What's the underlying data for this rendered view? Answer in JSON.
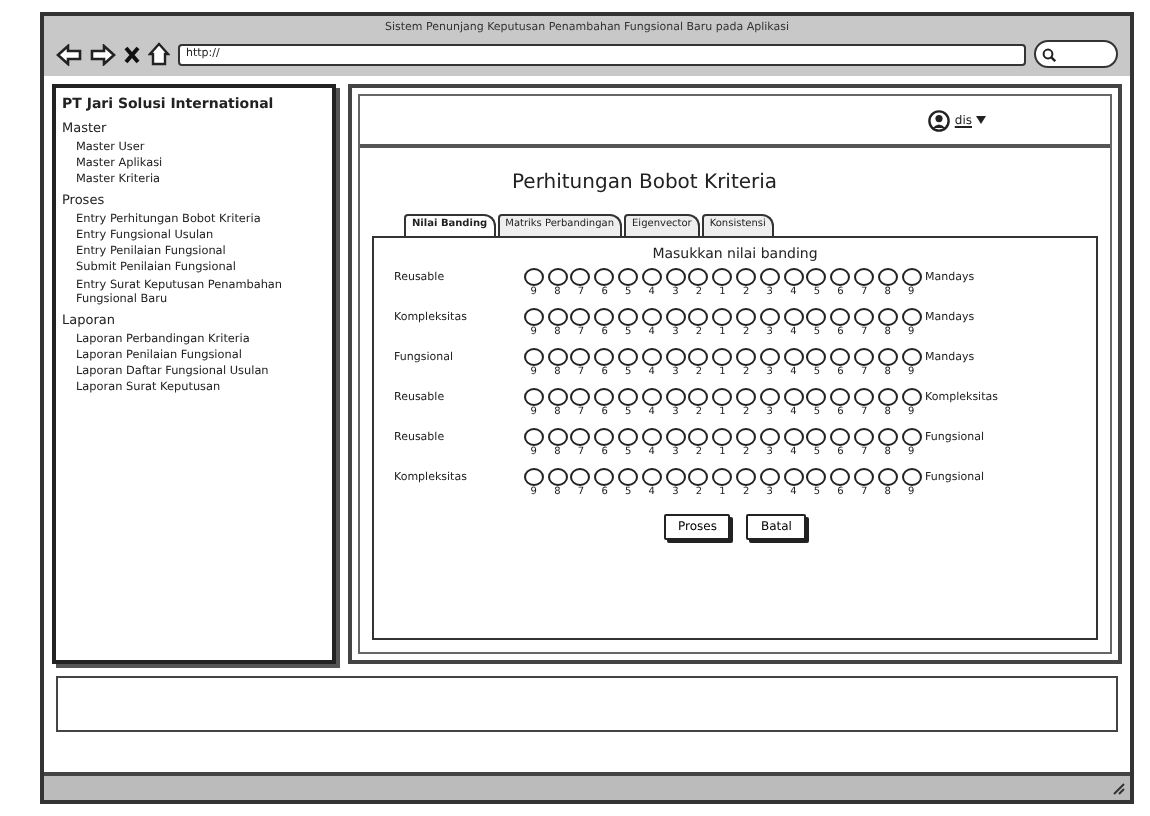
{
  "window": {
    "title": "Sistem Penunjang Keputusan Penambahan Fungsional Baru pada Aplikasi",
    "address": "http://"
  },
  "sidebar": {
    "title": "PT Jari Solusi International",
    "sections": [
      {
        "label": "Master",
        "items": [
          "Master User",
          "Master Aplikasi",
          "Master Kriteria"
        ]
      },
      {
        "label": "Proses",
        "items": [
          "Entry Perhitungan Bobot Kriteria",
          "Entry Fungsional Usulan",
          "Entry Penilaian Fungsional",
          "Submit Penilaian Fungsional",
          "Entry Surat Keputusan Penambahan Fungsional Baru"
        ]
      },
      {
        "label": "Laporan",
        "items": [
          "Laporan Perbandingan Kriteria",
          "Laporan Penilaian Fungsional",
          "Laporan Daftar Fungsional Usulan",
          "Laporan Surat Keputusan"
        ]
      }
    ]
  },
  "user": {
    "name": "dis"
  },
  "page_title": "Perhitungan Bobot Kriteria",
  "tabs": [
    {
      "label": "Nilai Banding",
      "selected": true
    },
    {
      "label": "Matriks Perbandingan",
      "selected": false
    },
    {
      "label": "Eigenvector",
      "selected": false
    },
    {
      "label": "Konsistensi",
      "selected": false
    }
  ],
  "form": {
    "heading": "Masukkan nilai banding",
    "rows": [
      {
        "left": "Reusable",
        "right": "Mandays",
        "options": [
          {
            "label": "9",
            "selected": false
          },
          {
            "label": "8",
            "selected": false
          },
          {
            "label": "7",
            "selected": false
          },
          {
            "label": "6",
            "selected": false
          },
          {
            "label": "5",
            "selected": false
          },
          {
            "label": "4",
            "selected": false
          },
          {
            "label": "3",
            "selected": false
          },
          {
            "label": "2",
            "selected": false
          },
          {
            "label": "1",
            "selected": false
          },
          {
            "label": "2",
            "selected": false
          },
          {
            "label": "3",
            "selected": false
          },
          {
            "label": "4",
            "selected": false
          },
          {
            "label": "5",
            "selected": false
          },
          {
            "label": "6",
            "selected": false
          },
          {
            "label": "7",
            "selected": false
          },
          {
            "label": "8",
            "selected": false
          },
          {
            "label": "9",
            "selected": false
          }
        ]
      },
      {
        "left": "Kompleksitas",
        "right": "Mandays",
        "options": [
          {
            "label": "9",
            "selected": false
          },
          {
            "label": "8",
            "selected": false
          },
          {
            "label": "7",
            "selected": false
          },
          {
            "label": "6",
            "selected": false
          },
          {
            "label": "5",
            "selected": false
          },
          {
            "label": "4",
            "selected": false
          },
          {
            "label": "3",
            "selected": false
          },
          {
            "label": "2",
            "selected": false
          },
          {
            "label": "1",
            "selected": false
          },
          {
            "label": "2",
            "selected": false
          },
          {
            "label": "3",
            "selected": false
          },
          {
            "label": "4",
            "selected": false
          },
          {
            "label": "5",
            "selected": false
          },
          {
            "label": "6",
            "selected": false
          },
          {
            "label": "7",
            "selected": false
          },
          {
            "label": "8",
            "selected": false
          },
          {
            "label": "9",
            "selected": false
          }
        ]
      },
      {
        "left": "Fungsional",
        "right": "Mandays",
        "options": [
          {
            "label": "9",
            "selected": false
          },
          {
            "label": "8",
            "selected": false
          },
          {
            "label": "7",
            "selected": false
          },
          {
            "label": "6",
            "selected": false
          },
          {
            "label": "5",
            "selected": false
          },
          {
            "label": "4",
            "selected": false
          },
          {
            "label": "3",
            "selected": false
          },
          {
            "label": "2",
            "selected": false
          },
          {
            "label": "1",
            "selected": false
          },
          {
            "label": "2",
            "selected": false
          },
          {
            "label": "3",
            "selected": false
          },
          {
            "label": "4",
            "selected": false
          },
          {
            "label": "5",
            "selected": false
          },
          {
            "label": "6",
            "selected": false
          },
          {
            "label": "7",
            "selected": false
          },
          {
            "label": "8",
            "selected": false
          },
          {
            "label": "9",
            "selected": false
          }
        ]
      },
      {
        "left": "Reusable",
        "right": "Kompleksitas",
        "options": [
          {
            "label": "9",
            "selected": false
          },
          {
            "label": "8",
            "selected": false
          },
          {
            "label": "7",
            "selected": false
          },
          {
            "label": "6",
            "selected": false
          },
          {
            "label": "5",
            "selected": false
          },
          {
            "label": "4",
            "selected": false
          },
          {
            "label": "3",
            "selected": false
          },
          {
            "label": "2",
            "selected": false
          },
          {
            "label": "1",
            "selected": false
          },
          {
            "label": "2",
            "selected": false
          },
          {
            "label": "3",
            "selected": false
          },
          {
            "label": "4",
            "selected": false
          },
          {
            "label": "5",
            "selected": false
          },
          {
            "label": "6",
            "selected": false
          },
          {
            "label": "7",
            "selected": false
          },
          {
            "label": "8",
            "selected": false
          },
          {
            "label": "9",
            "selected": false
          }
        ]
      },
      {
        "left": "Reusable",
        "right": "Fungsional",
        "options": [
          {
            "label": "9",
            "selected": false
          },
          {
            "label": "8",
            "selected": false
          },
          {
            "label": "7",
            "selected": false
          },
          {
            "label": "6",
            "selected": false
          },
          {
            "label": "5",
            "selected": false
          },
          {
            "label": "4",
            "selected": false
          },
          {
            "label": "3",
            "selected": false
          },
          {
            "label": "2",
            "selected": false
          },
          {
            "label": "1",
            "selected": false
          },
          {
            "label": "2",
            "selected": false
          },
          {
            "label": "3",
            "selected": false
          },
          {
            "label": "4",
            "selected": false
          },
          {
            "label": "5",
            "selected": false
          },
          {
            "label": "6",
            "selected": false
          },
          {
            "label": "7",
            "selected": false
          },
          {
            "label": "8",
            "selected": false
          },
          {
            "label": "9",
            "selected": false
          }
        ]
      },
      {
        "left": "Kompleksitas",
        "right": "Fungsional",
        "options": [
          {
            "label": "9",
            "selected": false
          },
          {
            "label": "8",
            "selected": false
          },
          {
            "label": "7",
            "selected": false
          },
          {
            "label": "6",
            "selected": false
          },
          {
            "label": "5",
            "selected": false
          },
          {
            "label": "4",
            "selected": false
          },
          {
            "label": "3",
            "selected": false
          },
          {
            "label": "2",
            "selected": false
          },
          {
            "label": "1",
            "selected": false
          },
          {
            "label": "2",
            "selected": false
          },
          {
            "label": "3",
            "selected": false
          },
          {
            "label": "4",
            "selected": false
          },
          {
            "label": "5",
            "selected": false
          },
          {
            "label": "6",
            "selected": false
          },
          {
            "label": "7",
            "selected": false
          },
          {
            "label": "8",
            "selected": false
          },
          {
            "label": "9",
            "selected": false
          }
        ]
      }
    ],
    "buttons": [
      "Proses",
      "Batal"
    ]
  }
}
